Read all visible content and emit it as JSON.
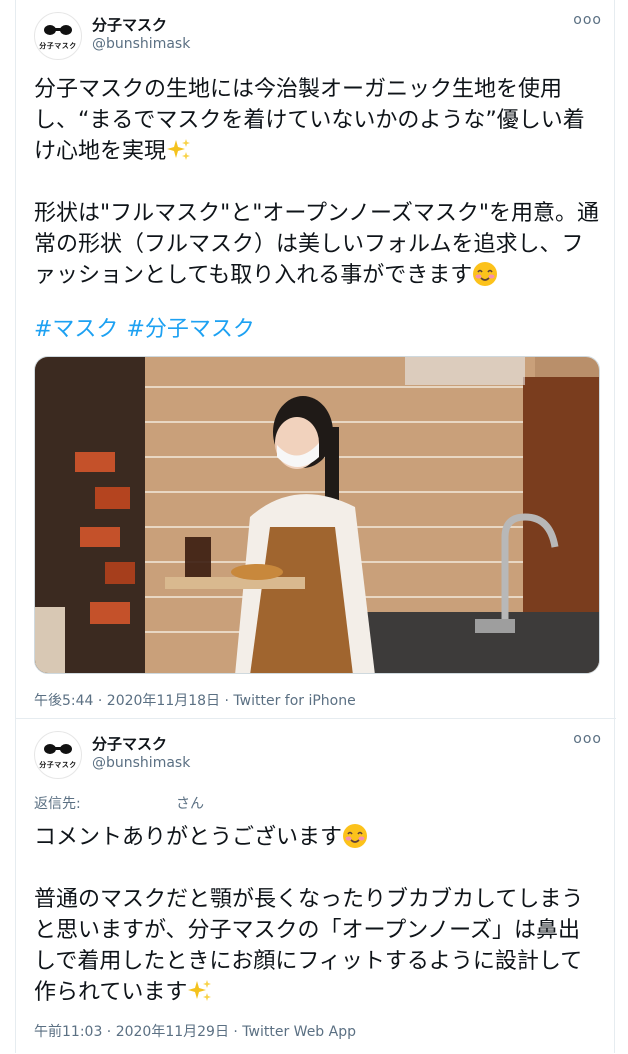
{
  "tweets": [
    {
      "author_name": "分子マスク",
      "author_handle": "@bunshimask",
      "avatar_text": "分子マスク",
      "more_label": "ooo",
      "body_lines": [
        "分子マスクの生地には今治製オーガニック生地を使用し、“まるでマスクを着けていないかのような”優しい着け心地を実現",
        "",
        "形状は\"フルマスク\"と\"オープンノーズマスク\"を用意。通常の形状（フルマスク）は美しいフォルムを追求し、ファッションとしても取り入れる事ができます"
      ],
      "hashtags": [
        "#マスク",
        "#分子マスク"
      ],
      "timestamp": "午後5:44 · 2020年11月18日 · Twitter for iPhone",
      "emoji": [
        "sparkles-icon",
        "smiling-face-icon"
      ]
    },
    {
      "author_name": "分子マスク",
      "author_handle": "@bunshimask",
      "avatar_text": "分子マスク",
      "more_label": "ooo",
      "reply_prefix": "返信先:",
      "reply_suffix": "さん",
      "body_lines": [
        "コメントありがとうございます",
        "",
        "普通のマスクだと顎が長くなったりブカブカしてしまうと思いますが、分子マスクの「オープンノーズ」は鼻出しで着用したときにお顔にフィットするように設計して作られています"
      ],
      "timestamp": "午前11:03 · 2020年11月29日 · Twitter Web App",
      "emoji": [
        "smiling-face-icon",
        "sparkles-icon"
      ]
    }
  ],
  "colors": {
    "link": "#1da1f2",
    "secondary_text": "#5b7083",
    "primary_text": "#0f1419",
    "divider": "#e6ecf0"
  }
}
